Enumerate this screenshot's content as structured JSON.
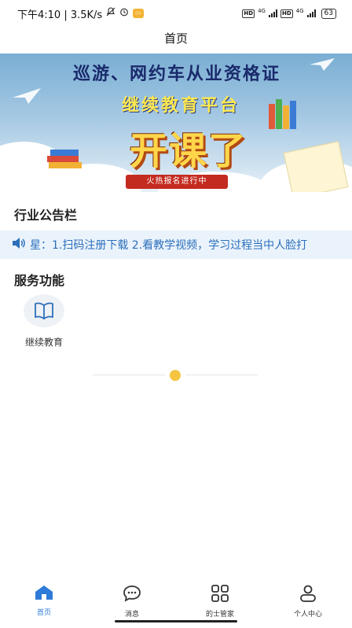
{
  "status_bar": {
    "time_speed": "下午4:10 | 3.5K/s",
    "hd1": "HD",
    "net1": "4G",
    "hd2": "HD",
    "net2": "4G",
    "battery": "63"
  },
  "header": {
    "title": "首页"
  },
  "banner": {
    "line1": "巡游、网约车从业资格证",
    "line2": "继续教育平台",
    "headline": "开课了",
    "ribbon": "火热报名进行中"
  },
  "notice": {
    "title": "行业公告栏",
    "text": "星：1.扫码注册下载 2.看教学视频，学习过程当中人脸打"
  },
  "services": {
    "title": "服务功能",
    "items": [
      {
        "label": "继续教育",
        "icon": "open-book-icon"
      }
    ]
  },
  "bottom_nav": {
    "items": [
      {
        "label": "首页",
        "icon": "home-icon",
        "active": true
      },
      {
        "label": "消息",
        "icon": "chat-bubble-icon",
        "active": false
      },
      {
        "label": "的士管家",
        "icon": "grid-icon",
        "active": false
      },
      {
        "label": "个人中心",
        "icon": "person-icon",
        "active": false
      }
    ]
  },
  "colors": {
    "accent": "#2f7bd9",
    "notice_bg": "#eaf3fc",
    "notice_text": "#2c6fbb"
  }
}
